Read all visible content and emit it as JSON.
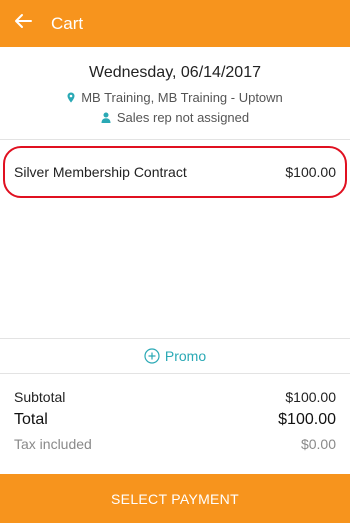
{
  "header": {
    "title": "Cart",
    "back_icon": "arrow-left-icon"
  },
  "colors": {
    "brand": "#f7941d",
    "accent": "#2aa9b5",
    "highlight": "#e01020"
  },
  "appointment": {
    "date": "Wednesday, 06/14/2017",
    "location": "MB Training, MB Training - Uptown",
    "sales_rep": "Sales rep not assigned"
  },
  "cart": {
    "items": [
      {
        "name": "Silver Membership Contract",
        "price": "$100.00"
      }
    ]
  },
  "promo": {
    "label": "Promo",
    "icon": "plus-circle-icon"
  },
  "totals": {
    "subtotal_label": "Subtotal",
    "subtotal_value": "$100.00",
    "total_label": "Total",
    "total_value": "$100.00",
    "tax_label": "Tax included",
    "tax_value": "$0.00"
  },
  "footer": {
    "button_label": "SELECT PAYMENT"
  }
}
